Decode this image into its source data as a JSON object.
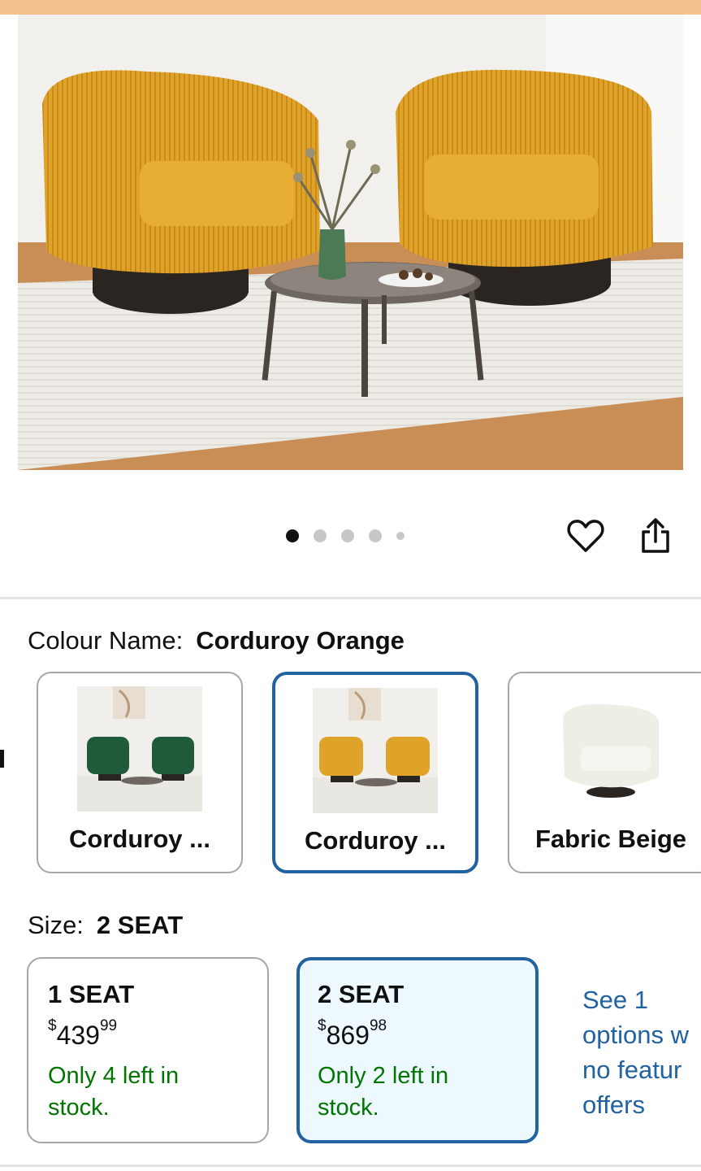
{
  "colors": {
    "accent": "#2162a1",
    "stock_green": "#007600",
    "top_strip": "#f3c28e"
  },
  "gallery": {
    "image_alt": "Two corduroy orange swivel barrel chairs with round coffee table",
    "dots_count": 5,
    "active_dot": 0
  },
  "actions": {
    "favorite_icon": "heart-icon",
    "share_icon": "share-icon"
  },
  "colour": {
    "label": "Colour Name:",
    "selected": "Corduroy Orange",
    "options": [
      {
        "label": "Corduroy ...",
        "selected": false
      },
      {
        "label": "Corduroy ...",
        "selected": true
      },
      {
        "label": "Fabric Beige",
        "selected": false
      }
    ]
  },
  "size": {
    "label": "Size:",
    "selected": "2 SEAT",
    "options": [
      {
        "title": "1 SEAT",
        "currency": "$",
        "price_whole": "439",
        "price_fraction": "99",
        "stock": "Only 4 left in stock.",
        "selected": false
      },
      {
        "title": "2 SEAT",
        "currency": "$",
        "price_whole": "869",
        "price_fraction": "98",
        "stock": "Only 2 left in stock.",
        "selected": true
      }
    ],
    "see_more": [
      "See 1",
      "options w",
      "no featur",
      "offers"
    ]
  }
}
